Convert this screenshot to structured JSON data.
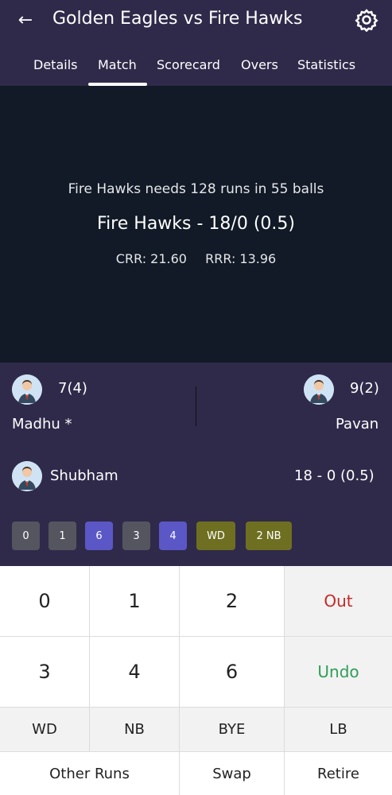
{
  "header": {
    "title": "Golden Eagles vs Fire Hawks"
  },
  "tabs": [
    {
      "label": "Details"
    },
    {
      "label": "Match"
    },
    {
      "label": "Scorecard"
    },
    {
      "label": "Overs"
    },
    {
      "label": "Statistics"
    }
  ],
  "active_tab": "Match",
  "score": {
    "needs_text": "Fire Hawks needs 128 runs in 55 balls",
    "team_score": "Fire Hawks - 18/0 (0.5)",
    "crr": "CRR: 21.60",
    "rrr": "RRR: 13.96"
  },
  "batters": {
    "striker": {
      "name": "Madhu *",
      "stat": "7(4)"
    },
    "non_striker": {
      "name": "Pavan",
      "stat": "9(2)"
    }
  },
  "bowler": {
    "name": "Shubham",
    "figures": "18 - 0 (0.5)"
  },
  "over_balls": [
    {
      "label": "0",
      "color": "#555560"
    },
    {
      "label": "1",
      "color": "#555560"
    },
    {
      "label": "6",
      "color": "#5b57c6"
    },
    {
      "label": "3",
      "color": "#555560"
    },
    {
      "label": "4",
      "color": "#5b57c6"
    },
    {
      "label": "WD",
      "color": "#6f6f22"
    },
    {
      "label": "2 NB",
      "color": "#6f6f22"
    }
  ],
  "keypad": {
    "k0": "0",
    "k1": "1",
    "k2": "2",
    "out": "Out",
    "k3": "3",
    "k4": "4",
    "k6": "6",
    "undo": "Undo",
    "wd": "WD",
    "nb": "NB",
    "bye": "BYE",
    "lb": "LB",
    "other_runs": "Other Runs",
    "swap": "Swap",
    "retire": "Retire"
  },
  "colors": {
    "header_bg": "#2f2a4a",
    "score_panel_bg": "#111a26",
    "out": "#c62828",
    "undo": "#2e9e57"
  }
}
